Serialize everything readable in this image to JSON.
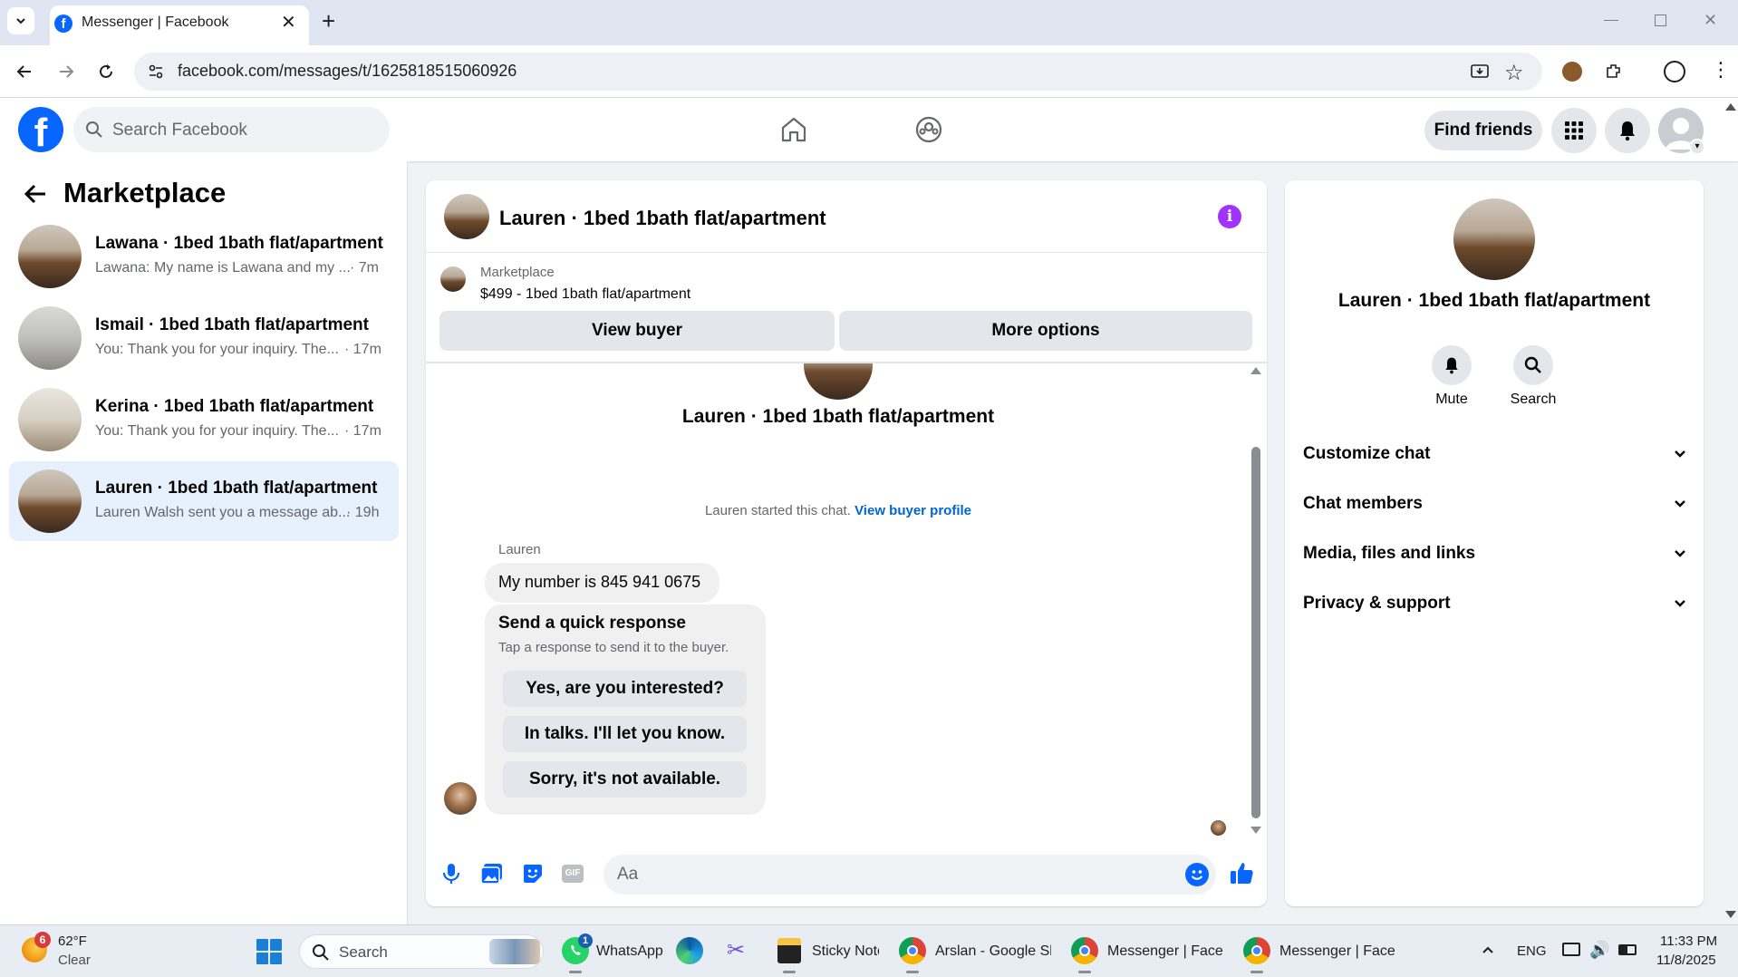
{
  "browser": {
    "tab_title": "Messenger | Facebook",
    "url": "facebook.com/messages/t/1625818515060926"
  },
  "header": {
    "search_placeholder": "Search Facebook",
    "find_friends": "Find friends"
  },
  "sidebar": {
    "title": "Marketplace",
    "conversations": [
      {
        "name": "Lawana · 1bed 1bath flat/apartment",
        "snippet": "Lawana: My name is Lawana and my ...",
        "time": "· 7m",
        "active": false
      },
      {
        "name": "Ismail · 1bed 1bath flat/apartment",
        "snippet": "You: Thank you for your inquiry. The...",
        "time": "· 17m",
        "active": false
      },
      {
        "name": "Kerina · 1bed 1bath flat/apartment",
        "snippet": "You: Thank you for your inquiry. The...",
        "time": "· 17m",
        "active": false
      },
      {
        "name": "Lauren · 1bed 1bath flat/apartment",
        "snippet": "Lauren Walsh sent you a message ab...",
        "time": "· 19h",
        "active": true
      }
    ]
  },
  "chat": {
    "title": "Lauren · 1bed 1bath flat/apartment",
    "listing_source": "Marketplace",
    "listing": "$499 - 1bed 1bath flat/apartment",
    "view_buyer": "View buyer",
    "more_options": "More options",
    "center_name": "Lauren · 1bed 1bath flat/apartment",
    "started_text": "Lauren started this chat.",
    "view_buyer_profile": "View buyer profile",
    "sender": "Lauren",
    "message": "My number is 845 941 0675",
    "quick_title": "Send a quick response",
    "quick_subtitle": "Tap a response to send it to the buyer.",
    "quick_responses": [
      "Yes, are you interested?",
      "In talks. I'll let you know.",
      "Sorry, it's not available."
    ],
    "composer_placeholder": "Aa"
  },
  "right_panel": {
    "name": "Lauren · 1bed 1bath flat/apartment",
    "mute": "Mute",
    "search": "Search",
    "sections": [
      "Customize chat",
      "Chat members",
      "Media, files and links",
      "Privacy & support"
    ]
  },
  "taskbar": {
    "weather_temp": "62°F",
    "weather_desc": "Clear",
    "weather_badge": "6",
    "search": "Search",
    "apps": [
      {
        "label": "WhatsApp",
        "badge": "1"
      },
      {
        "label": "Sticky Note"
      },
      {
        "label": "Arslan - Google Sh"
      },
      {
        "label": "Messenger | Faceb"
      },
      {
        "label": "Messenger | Faceb"
      }
    ],
    "lang": "ENG",
    "time": "11:33 PM",
    "date": "11/8/2025"
  },
  "colors": {
    "fb_blue": "#0866ff",
    "link_blue": "#0064d1",
    "info_purple": "#a033ff",
    "active_row": "#e7f0fd"
  }
}
